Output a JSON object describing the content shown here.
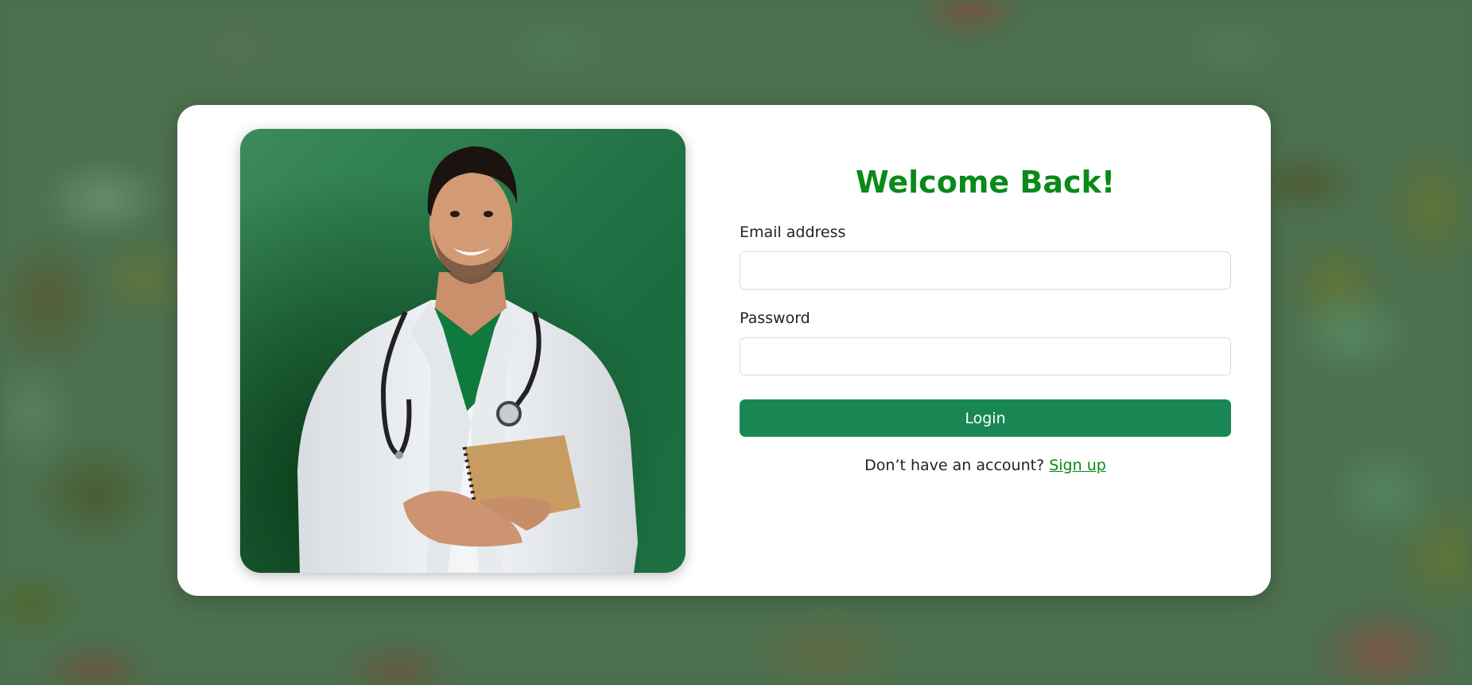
{
  "page": {
    "heading": "Welcome Back!"
  },
  "form": {
    "email_label": "Email address",
    "email_value": "",
    "password_label": "Password",
    "password_value": "",
    "login_label": "Login",
    "signup_prompt": "Don’t have an account?",
    "signup_link": "Sign up"
  },
  "colors": {
    "accent": "#0a8a18",
    "button": "#198754",
    "photo_background": "#237547"
  },
  "image": {
    "subject": "doctor-photo"
  }
}
